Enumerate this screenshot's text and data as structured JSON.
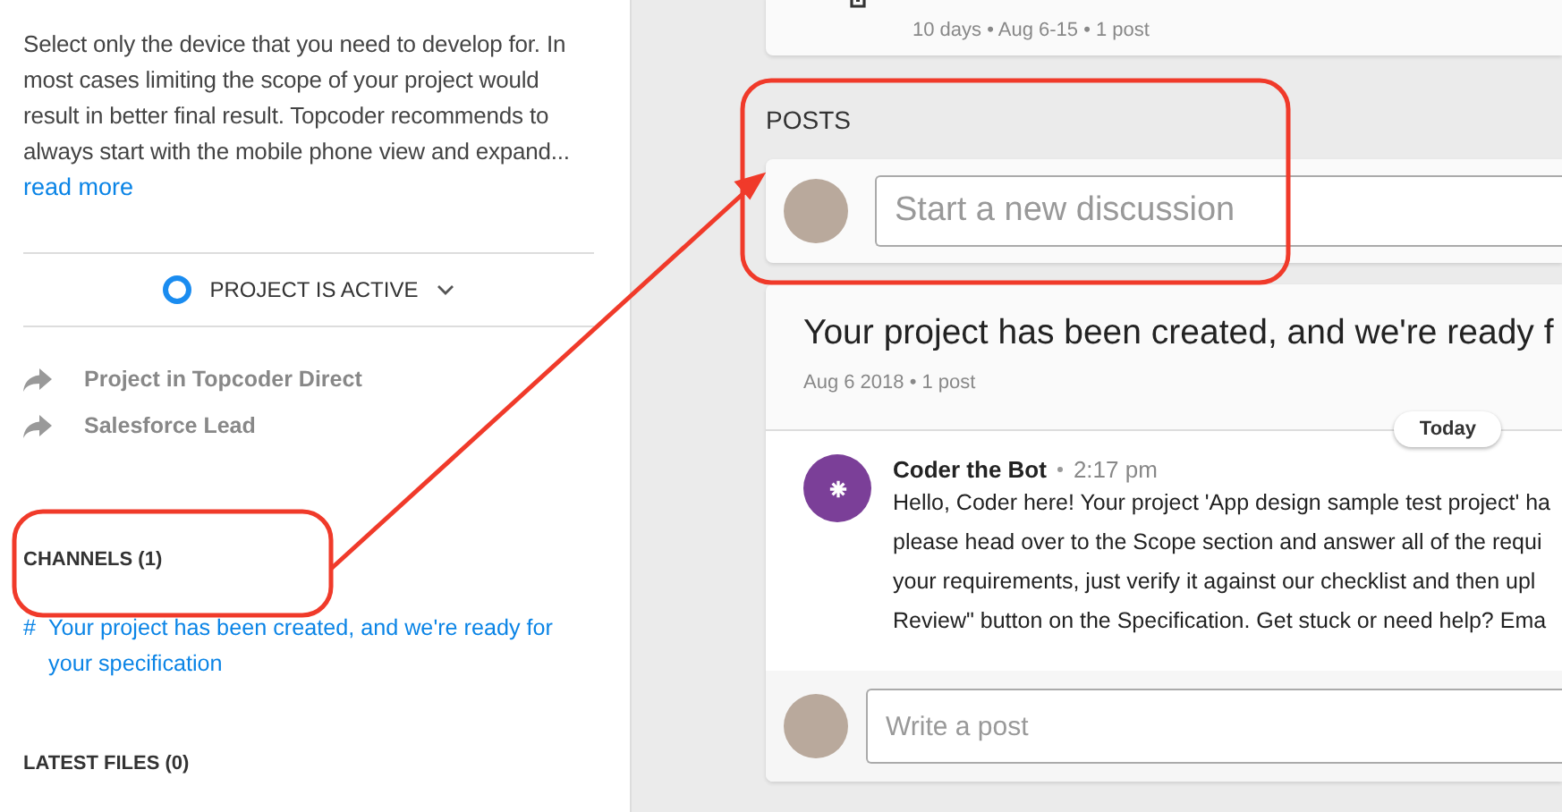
{
  "sidebar": {
    "description": "Select only the device that you need to develop for. In most cases limiting the scope of your project would result in better final result. Topcoder recommends to always start with the mobile phone view and expand...",
    "read_more": "read more",
    "status": {
      "label": "PROJECT IS ACTIVE"
    },
    "links": [
      {
        "label": "Project in Topcoder Direct"
      },
      {
        "label": "Salesforce Lead"
      }
    ],
    "channels": {
      "heading": "CHANNELS (1)",
      "items": [
        {
          "symbol": "#",
          "title": "Your project has been created, and we're ready for your specification"
        }
      ]
    },
    "latest_files": {
      "heading": "LATEST FILES (0)"
    }
  },
  "main": {
    "top_card": {
      "meta": "10 days • Aug 6-15 • 1 post"
    },
    "posts_heading": "POSTS",
    "new_discussion": {
      "placeholder": "Start a new discussion"
    },
    "thread": {
      "title": "Your project has been created, and we're ready f",
      "meta": "Aug 6 2018 • 1 post",
      "day_label": "Today",
      "message": {
        "author": "Coder the Bot",
        "time": "2:17 pm",
        "lines": [
          "Hello, Coder here! Your project 'App design sample test project' ha",
          "please head over to the Scope section and answer all of the requi",
          "your requirements, just verify it against our checklist and then upl",
          "Review\" button on the Specification. Get stuck or need help? Ema"
        ]
      },
      "reply": {
        "placeholder": "Write a post"
      }
    }
  }
}
